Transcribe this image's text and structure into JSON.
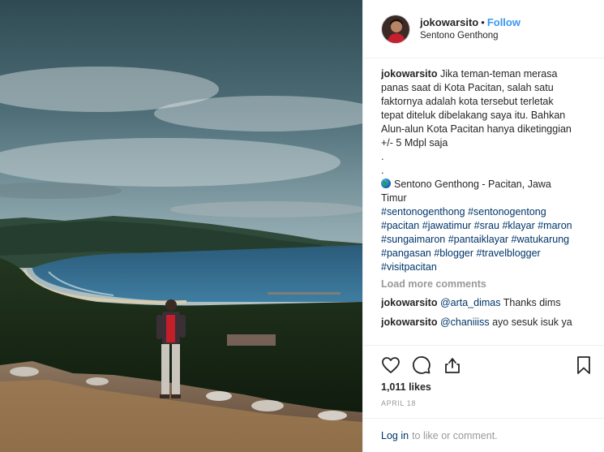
{
  "header": {
    "username": "jokowarsito",
    "separator": "•",
    "follow_label": "Follow",
    "location": "Sentono Genthong"
  },
  "caption": {
    "username": "jokowarsito",
    "lines": [
      "Jika teman-teman merasa",
      "panas saat di Kota Pacitan, salah satu",
      "faktornya adalah kota tersebut terletak",
      "tepat diteluk dibelakang saya itu. Bahkan",
      "Alun-alun Kota Pacitan hanya diketinggian",
      "+/- 5 Mdpl saja"
    ],
    "dots": [
      ".",
      "."
    ],
    "place_line1": "Sentono Genthong - Pacitan, Jawa",
    "place_line2": "Timur",
    "hashtag_lines": [
      [
        "#sentonogenthong",
        "#sentonogentong"
      ],
      [
        "#pacitan",
        "#jawatimur",
        "#srau",
        "#klayar",
        "#maron"
      ],
      [
        "#sungaimaron",
        "#pantaiklayar",
        "#watukarung"
      ],
      [
        "#pangasan",
        "#blogger",
        "#travelblogger"
      ],
      [
        "#visitpacitan"
      ]
    ]
  },
  "load_more_label": "Load more comments",
  "comments": [
    {
      "username": "jokowarsito",
      "mention": "@arta_dimas",
      "text": "Thanks dims"
    },
    {
      "username": "jokowarsito",
      "mention": "@chaniiiss",
      "text": "ayo sesuk isuk ya"
    }
  ],
  "actions": {
    "like_icon": "heart-icon",
    "comment_icon": "comment-icon",
    "share_icon": "share-icon",
    "save_icon": "bookmark-icon"
  },
  "likes_label": "1,011 likes",
  "date_label": "APRIL 18",
  "login": {
    "link_label": "Log in",
    "rest_label": "to like or comment."
  },
  "colors": {
    "link": "#003569",
    "follow": "#3897f0",
    "muted": "#999999"
  }
}
